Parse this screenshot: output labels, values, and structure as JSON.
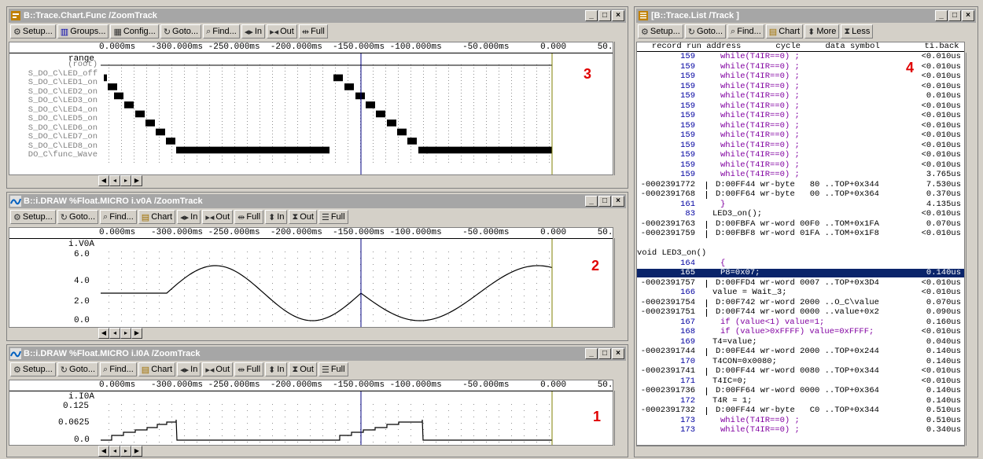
{
  "chartwin": {
    "title": "B::Trace.Chart.Func /ZoomTrack",
    "buttons": [
      "Setup...",
      "Groups...",
      "Config...",
      "Goto...",
      "Find...",
      "In",
      "Out",
      "Full"
    ],
    "scale": "0.000ms   -300.000ms -250.000ms  -200.000ms  -150.000ms -100.000ms    -50.000ms      0.000      50.",
    "ylabel": "range",
    "labels": [
      "(root)",
      "S_DO_C\\LED_off",
      "S_DO_C\\LED1_on",
      "S_DO_C\\LED2_on",
      "S_DO_C\\LED3_on",
      "S_DO_C\\LED4_on",
      "S_DO_C\\LED5_on",
      "S_DO_C\\LED6_on",
      "S_DO_C\\LED7_on",
      "S_DO_C\\LED8_on",
      "DO_C\\func_Wave"
    ],
    "marker": "3"
  },
  "voawin": {
    "title": "B::i.DRAW %Float.MICRO i.v0A /ZoomTrack",
    "buttons": [
      "Setup...",
      "Goto...",
      "Find...",
      "Chart",
      "In",
      "Out",
      "Full",
      "In",
      "Out",
      "Full"
    ],
    "scale": "0.000ms   -300.000ms -250.000ms  -200.000ms  -150.000ms -100.000ms    -50.000ms      0.000      50.",
    "ylabel": "i.V0A",
    "ticks": [
      "6.0",
      "4.0",
      "2.0",
      "0.0"
    ],
    "marker": "2"
  },
  "ioawin": {
    "title": "B::i.DRAW %Float.MICRO i.I0A /ZoomTrack",
    "buttons": [
      "Setup...",
      "Goto...",
      "Find...",
      "Chart",
      "In",
      "Out",
      "Full",
      "In",
      "Out",
      "Full"
    ],
    "scale": "0.000ms   -300.000ms -250.000ms  -200.000ms  -150.000ms -100.000ms    -50.000ms      0.000      50.",
    "ylabel": "i.I0A",
    "ticks": [
      "0.125",
      "0.0625",
      "0.0"
    ],
    "marker": "1"
  },
  "listwin": {
    "title": "[B::Trace.List /Track ]",
    "buttons": [
      "Setup...",
      "Goto...",
      "Find...",
      "Chart",
      "More",
      "Less"
    ],
    "header": "   record run address       cycle     data symbol         ti.back",
    "marker": "4",
    "rows": [
      {
        "t": "s",
        "rec": "159",
        "txt": "while(T4IR==0) ;",
        "ti": "<0.010us"
      },
      {
        "t": "s",
        "rec": "159",
        "txt": "while(T4IR==0) ;",
        "ti": "<0.010us"
      },
      {
        "t": "s",
        "rec": "159",
        "txt": "while(T4IR==0) ;",
        "ti": "<0.010us"
      },
      {
        "t": "s",
        "rec": "159",
        "txt": "while(T4IR==0) ;",
        "ti": "<0.010us"
      },
      {
        "t": "s",
        "rec": "159",
        "txt": "while(T4IR==0) ;",
        "ti": "0.010us"
      },
      {
        "t": "s",
        "rec": "159",
        "txt": "while(T4IR==0) ;",
        "ti": "<0.010us"
      },
      {
        "t": "s",
        "rec": "159",
        "txt": "while(T4IR==0) ;",
        "ti": "<0.010us"
      },
      {
        "t": "s",
        "rec": "159",
        "txt": "while(T4IR==0) ;",
        "ti": "<0.010us"
      },
      {
        "t": "s",
        "rec": "159",
        "txt": "while(T4IR==0) ;",
        "ti": "<0.010us"
      },
      {
        "t": "s",
        "rec": "159",
        "txt": "while(T4IR==0) ;",
        "ti": "<0.010us"
      },
      {
        "t": "s",
        "rec": "159",
        "txt": "while(T4IR==0) ;",
        "ti": "<0.010us"
      },
      {
        "t": "s",
        "rec": "159",
        "txt": "while(T4IR==0) ;",
        "ti": "<0.010us"
      },
      {
        "t": "s",
        "rec": "159",
        "txt": "while(T4IR==0) ;",
        "ti": "3.765us"
      },
      {
        "t": "b",
        "rec": "-0002391772",
        "txt": "D:00FF44 wr-byte   80 ..TOP+0x344",
        "ti": "7.530us"
      },
      {
        "t": "b",
        "rec": "-0002391768",
        "txt": "D:00FF64 wr-byte   00 ..TOP+0x364",
        "ti": "0.370us"
      },
      {
        "t": "s",
        "rec": "161",
        "txt": "}",
        "ti": "4.135us"
      },
      {
        "t": "c",
        "rec": "83",
        "txt": "LED3_on();",
        "ti": "<0.010us"
      },
      {
        "t": "b",
        "rec": "-0002391763",
        "txt": "D:00FBFA wr-word 00F0 ..TOM+0x1FA",
        "ti": "0.070us"
      },
      {
        "t": "b",
        "rec": "-0002391759",
        "txt": "D:00FBF8 wr-word 01FA ..TOM+0x1F8",
        "ti": "<0.010us"
      },
      {
        "t": "e",
        "rec": "",
        "txt": "",
        "ti": ""
      },
      {
        "t": "f",
        "rec": "",
        "txt": "void LED3_on()",
        "ti": ""
      },
      {
        "t": "s",
        "rec": "164",
        "txt": "{",
        "ti": ""
      },
      {
        "t": "h",
        "rec": "165",
        "txt": "P8=0x07;",
        "ti": "0.140us"
      },
      {
        "t": "b",
        "rec": "-0002391757",
        "txt": "D:00FFD4 wr-word 0007 ..TOP+0x3D4",
        "ti": "<0.010us"
      },
      {
        "t": "c",
        "rec": "166",
        "txt": "value = Wait_3;",
        "ti": "<0.010us"
      },
      {
        "t": "b",
        "rec": "-0002391754",
        "txt": "D:00F742 wr-word 2000 ..O_C\\value",
        "ti": "0.070us"
      },
      {
        "t": "b",
        "rec": "-0002391751",
        "txt": "D:00F744 wr-word 0000 ..value+0x2",
        "ti": "0.090us"
      },
      {
        "t": "s",
        "rec": "167",
        "txt": "if (value<1) value=1;",
        "ti": "0.160us"
      },
      {
        "t": "s",
        "rec": "168",
        "txt": "if (value>0xFFFF) value=0xFFFF;",
        "ti": "<0.010us"
      },
      {
        "t": "c",
        "rec": "169",
        "txt": "T4=value;",
        "ti": "0.040us"
      },
      {
        "t": "b",
        "rec": "-0002391744",
        "txt": "D:00FE44 wr-word 2000 ..TOP+0x244",
        "ti": "0.140us"
      },
      {
        "t": "c",
        "rec": "170",
        "txt": "T4CON=0x0080;",
        "ti": "0.140us"
      },
      {
        "t": "b",
        "rec": "-0002391741",
        "txt": "D:00FF44 wr-word 0080 ..TOP+0x344",
        "ti": "<0.010us"
      },
      {
        "t": "c",
        "rec": "171",
        "txt": "T4IC=0;",
        "ti": "<0.010us"
      },
      {
        "t": "b",
        "rec": "-0002391736",
        "txt": "D:00FF64 wr-word 0000 ..TOP+0x364",
        "ti": "0.140us"
      },
      {
        "t": "c",
        "rec": "172",
        "txt": "T4R = 1;",
        "ti": "0.140us"
      },
      {
        "t": "b",
        "rec": "-0002391732",
        "txt": "D:00FF44 wr-byte   C0 ..TOP+0x344",
        "ti": "0.510us"
      },
      {
        "t": "s",
        "rec": "173",
        "txt": "while(T4IR==0) ;",
        "ti": "0.510us"
      },
      {
        "t": "s",
        "rec": "173",
        "txt": "while(T4IR==0) ;",
        "ti": "0.340us"
      }
    ]
  },
  "colors": {
    "title_inactive": "#a6a6a6",
    "selection": "#0a246a",
    "marker": "#e00000",
    "cursor": "#000080",
    "source": "#8000a0",
    "bus": "#0000a0"
  }
}
